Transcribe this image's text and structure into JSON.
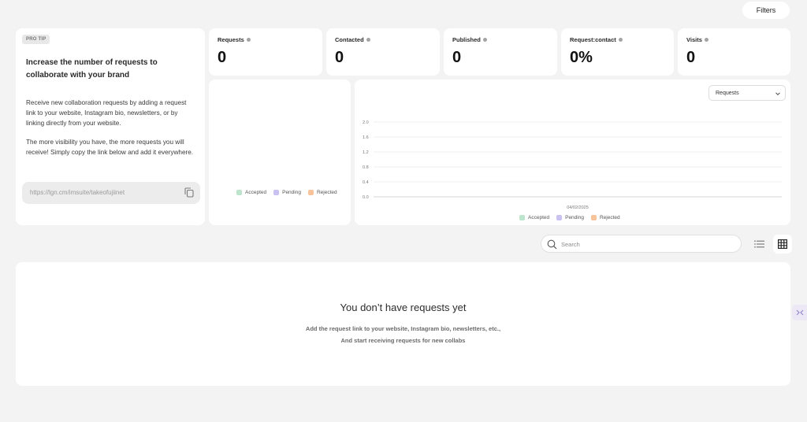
{
  "toolbar": {
    "filters_label": "Filters"
  },
  "tip": {
    "badge": "PRO TIP",
    "title": "Increase the number of requests to collaborate with your brand",
    "paragraph1": "Receive new collaboration requests by adding a request link to your website, Instagram bio, newsletters, or by linking directly from your website.",
    "paragraph2": "The more visibility you have, the more requests you will receive! Simply copy the link below and add it everywhere.",
    "link": "https://lgn.cm/imsuite/takeofujiinet"
  },
  "stats": [
    {
      "label": "Requests",
      "value": "0"
    },
    {
      "label": "Contacted",
      "value": "0"
    },
    {
      "label": "Published",
      "value": "0"
    },
    {
      "label": "Request:contact",
      "value": "0%"
    },
    {
      "label": "Visits",
      "value": "0"
    }
  ],
  "legend": [
    {
      "label": "Accepted",
      "color": "#bde5cd"
    },
    {
      "label": "Pending",
      "color": "#c9c1f2"
    },
    {
      "label": "Rejected",
      "color": "#f7c39a"
    }
  ],
  "metric_select": {
    "value": "Requests"
  },
  "chart_data": {
    "type": "line",
    "x": [
      "04/02/2025"
    ],
    "series": [
      {
        "name": "Accepted",
        "values": [
          0
        ]
      },
      {
        "name": "Pending",
        "values": [
          0
        ]
      },
      {
        "name": "Rejected",
        "values": [
          0
        ]
      }
    ],
    "yticks": [
      "2.0",
      "1.6",
      "1.2",
      "0.8",
      "0.4",
      "0.0"
    ],
    "ylim": [
      0,
      2.0
    ],
    "grid": true,
    "legend_position": "bottom"
  },
  "search": {
    "placeholder": "Search"
  },
  "empty": {
    "title": "You don’t have requests yet",
    "line1": "Add the request link to your website, Instagram bio, newsletters, etc.,",
    "line2": "And start receiving requests for new collabs"
  }
}
